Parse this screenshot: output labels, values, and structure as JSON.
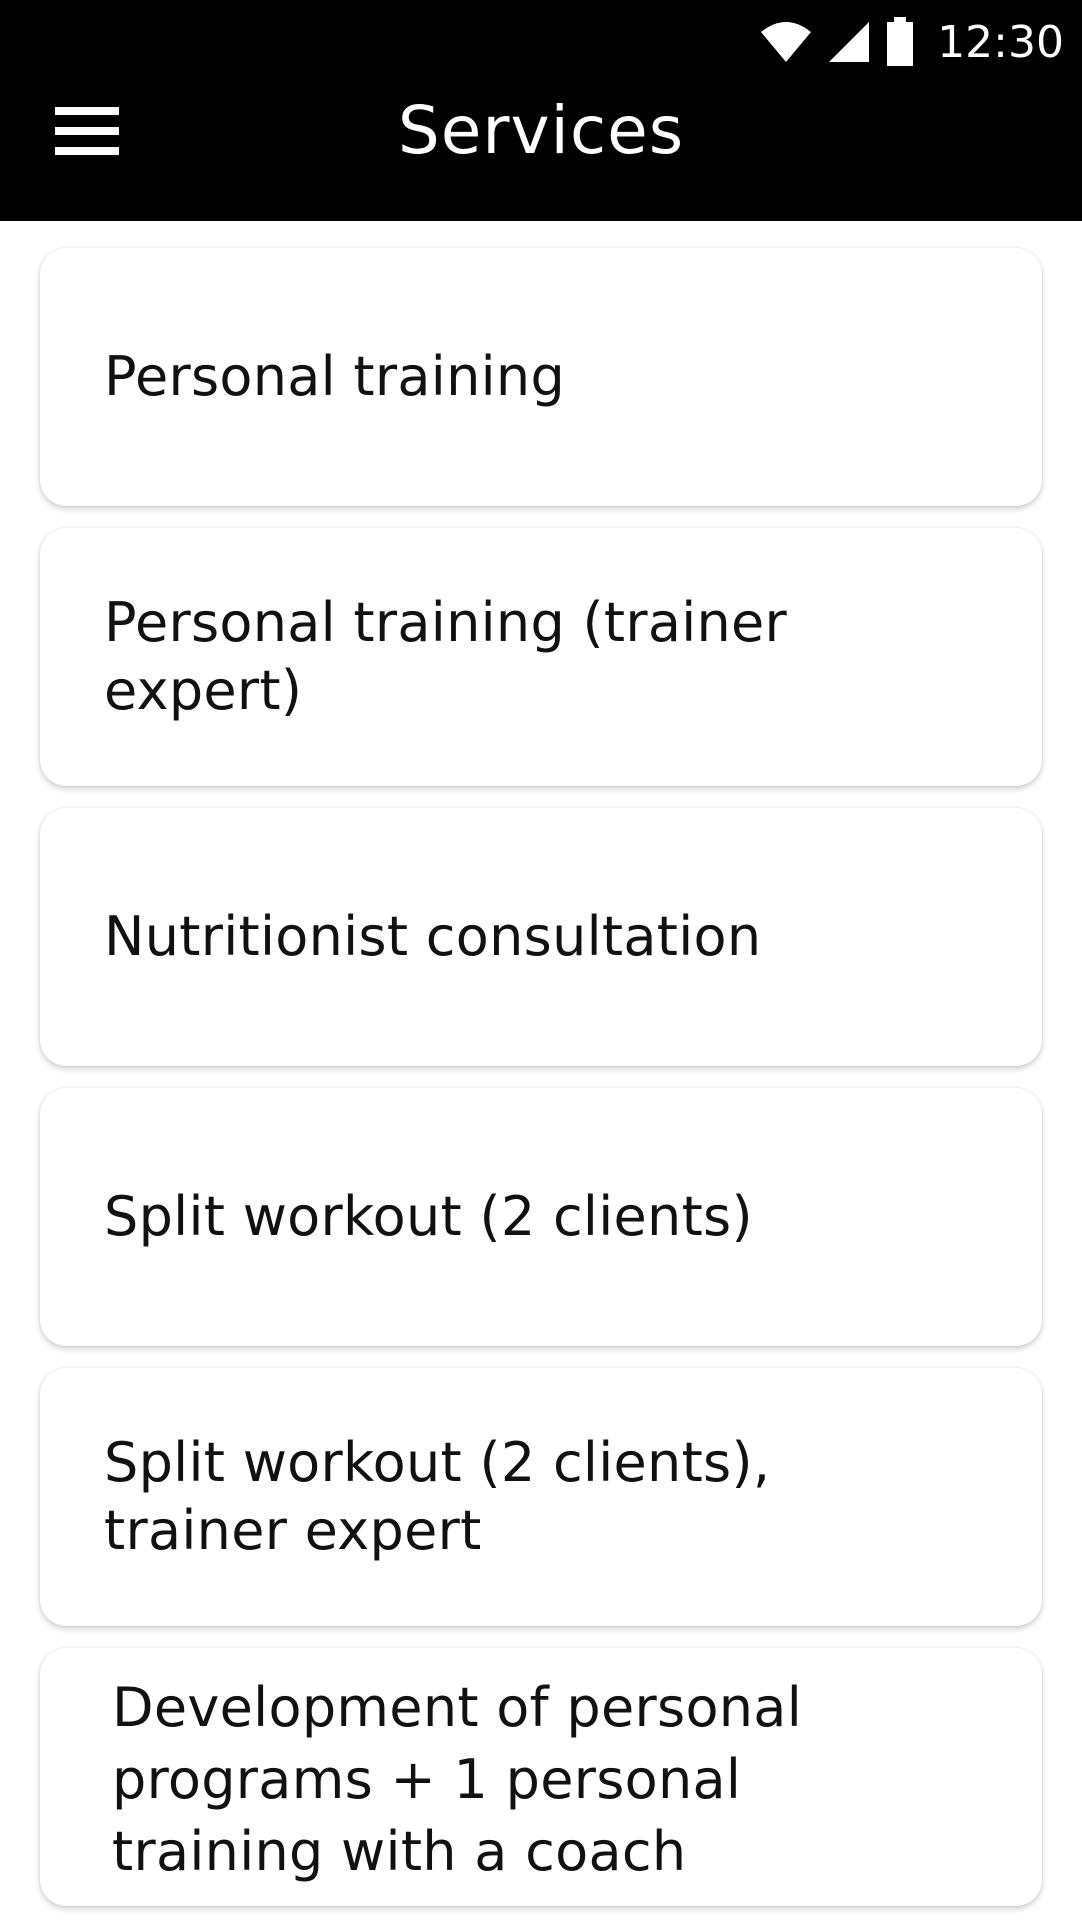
{
  "status_bar": {
    "time": "12:30",
    "icons": [
      "wifi-icon",
      "signal-icon",
      "battery-icon"
    ]
  },
  "app_bar": {
    "title": "Services",
    "menu_icon": "hamburger-menu-icon",
    "background_color": "#000000",
    "text_color": "#ffffff"
  },
  "services": [
    {
      "label": "Personal training"
    },
    {
      "label": "Personal training (trainer expert)"
    },
    {
      "label": "Nutritionist consultation"
    },
    {
      "label": "Split workout (2 clients)"
    },
    {
      "label": "Split workout (2 clients),\ntrainer expert"
    },
    {
      "label": "Development of personal\nprograms + 1 personal\ntraining with a coach"
    }
  ]
}
